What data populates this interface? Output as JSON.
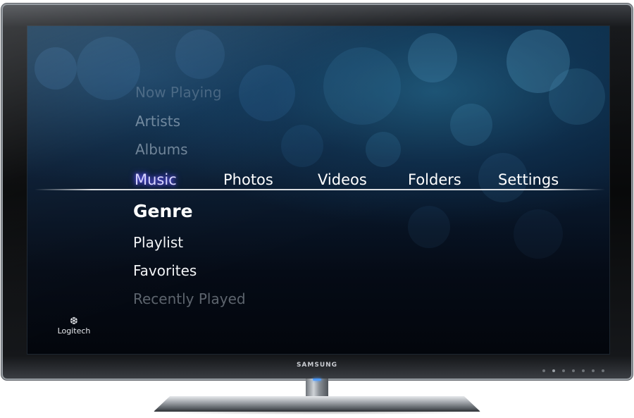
{
  "tv": {
    "brand": "SAMSUNG"
  },
  "app": {
    "logo_text": "Logitech",
    "logo_icon": "logitech-icon",
    "accent": "#6c5cff"
  },
  "menu_above": [
    {
      "label": "Now Playing"
    },
    {
      "label": "Artists"
    },
    {
      "label": "Albums"
    }
  ],
  "tabs": [
    {
      "label": "Music",
      "active": true
    },
    {
      "label": "Photos",
      "active": false
    },
    {
      "label": "Videos",
      "active": false
    },
    {
      "label": "Folders",
      "active": false
    },
    {
      "label": "Settings",
      "active": false
    }
  ],
  "submenu": [
    {
      "label": "Genre",
      "selected": true
    },
    {
      "label": "Playlist",
      "selected": false
    },
    {
      "label": "Favorites",
      "selected": false
    },
    {
      "label": "Recently Played",
      "selected": false
    }
  ]
}
